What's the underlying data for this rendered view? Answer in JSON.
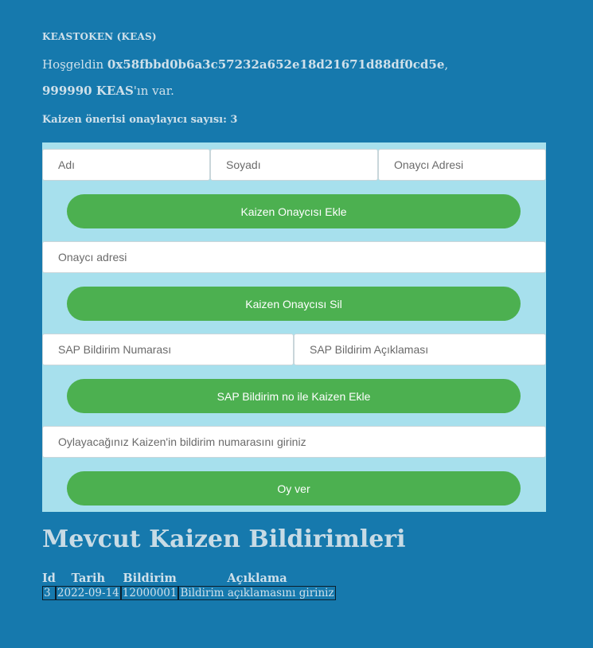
{
  "header": {
    "token_title": "KEASTOKEN (KEAS)",
    "greeting_prefix": "Hoşgeldin ",
    "address": "0x58fbbd0b6a3c57232a652e18d21671d88df0cd5e",
    "greeting_suffix": ",",
    "balance_value": "999990 KEAS",
    "balance_suffix": "'ın var.",
    "approver_count_text": "Kaizen önerisi onaylayıcı sayısı: 3"
  },
  "form": {
    "first_name_placeholder": "Adı",
    "last_name_placeholder": "Soyadı",
    "approver_address_placeholder": "Onaycı Adresi",
    "add_approver_label": "Kaizen Onaycısı Ekle",
    "remove_address_placeholder": "Onaycı adresi",
    "remove_approver_label": "Kaizen Onaycısı Sil",
    "sap_number_placeholder": "SAP Bildirim Numarası",
    "sap_description_placeholder": "SAP Bildirim Açıklaması",
    "add_kaizen_label": "SAP Bildirim no ile Kaizen Ekle",
    "vote_placeholder": "Oylayacağınız Kaizen'in bildirim numarasını giriniz",
    "vote_label": "Oy ver"
  },
  "reports": {
    "title": "Mevcut Kaizen Bildirimleri",
    "columns": [
      "Id",
      "Tarih",
      "Bildirim",
      "Açıklama"
    ],
    "rows": [
      [
        "3",
        "2022-09-14",
        "12000001",
        "Bildirim açıklamasını giriniz"
      ]
    ]
  },
  "colors": {
    "background": "#1679ad",
    "panel": "#a7e0ed",
    "button": "#4cb050"
  }
}
